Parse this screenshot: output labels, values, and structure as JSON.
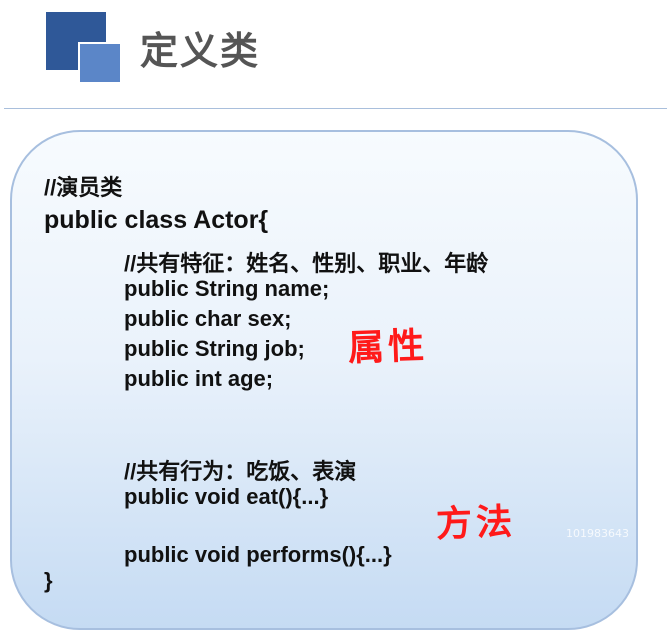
{
  "header": {
    "title": "定义类"
  },
  "code": {
    "comment_class": "//演员类",
    "class_decl": "public class Actor{",
    "comment_fields": "//共有特征：姓名、性别、职业、年龄",
    "fields": [
      "public String name;",
      "public char sex;",
      "public String job;",
      "public int age;"
    ],
    "comment_methods": "//共有行为：吃饭、表演",
    "methods": [
      "public void eat(){...}",
      "public void performs(){...}"
    ],
    "class_close": "}"
  },
  "annotations": {
    "attributes": "属性",
    "methods": "方法"
  },
  "watermark": "101983643",
  "colors": {
    "logo_dark": "#2f5898",
    "logo_light": "#5b86c8",
    "title": "#555555",
    "annotation": "#ff1a1a",
    "panel_border": "#a7bfdf"
  }
}
